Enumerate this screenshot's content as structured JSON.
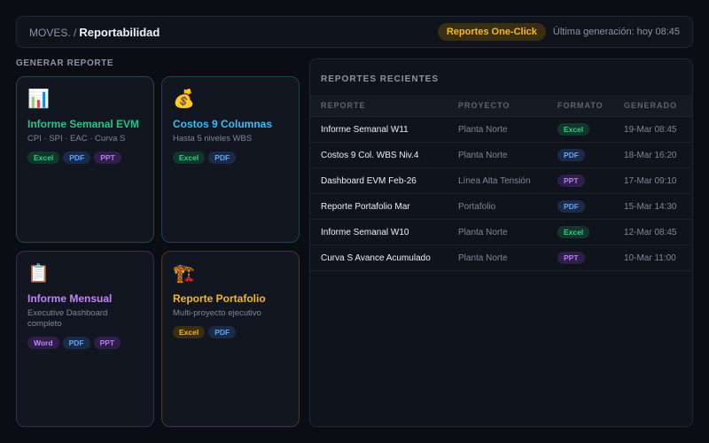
{
  "header": {
    "brand": "MOVES. /",
    "title": "Reportabilidad",
    "badge": "Reportes One-Click",
    "last_generation": "Última generación: hoy 08:45"
  },
  "section_label": "GENERAR REPORTE",
  "cards": [
    {
      "icon": "📊",
      "icon_name": "bar-chart-icon",
      "title": "Informe Semanal EVM",
      "subtitle": "CPI · SPI · EAC · Curva S",
      "formats": [
        "Excel",
        "PDF",
        "PPT"
      ],
      "color": "#22c58b"
    },
    {
      "icon": "💰",
      "icon_name": "money-bag-icon",
      "title": "Costos 9 Columnas",
      "subtitle": "Hasta 5 niveles WBS",
      "formats": [
        "Excel",
        "PDF"
      ],
      "color": "#38bdf8"
    },
    {
      "icon": "📋",
      "icon_name": "clipboard-icon",
      "title": "Informe Mensual",
      "subtitle": "Executive Dashboard completo",
      "formats": [
        "Word",
        "PDF",
        "PPT"
      ],
      "color": "#c084fc"
    },
    {
      "icon": "🏗️",
      "icon_name": "crane-icon",
      "title": "Reporte Portafolio",
      "subtitle": "Multi-proyecto ejecutivo",
      "formats": [
        "Excel",
        "PDF"
      ],
      "color": "#f5b820"
    }
  ],
  "recent": {
    "title": "REPORTES RECIENTES",
    "columns": [
      "REPORTE",
      "PROYECTO",
      "FORMATO",
      "GENERADO"
    ],
    "rows": [
      {
        "report": "Informe Semanal W11",
        "project": "Planta Norte",
        "format": "Excel",
        "generated": "19-Mar 08:45"
      },
      {
        "report": "Costos 9 Col. WBS Niv.4",
        "project": "Planta Norte",
        "format": "PDF",
        "generated": "18-Mar 16:20"
      },
      {
        "report": "Dashboard EVM Feb-26",
        "project": "Línea Alta Tensión",
        "format": "PPT",
        "generated": "17-Mar 09:10"
      },
      {
        "report": "Reporte Portafolio Mar",
        "project": "Portafolio",
        "format": "PDF",
        "generated": "15-Mar 14:30"
      },
      {
        "report": "Informe Semanal W10",
        "project": "Planta Norte",
        "format": "Excel",
        "generated": "12-Mar 08:45"
      },
      {
        "report": "Curva S Avance Acumulado",
        "project": "Planta Norte",
        "format": "PPT",
        "generated": "10-Mar 11:00"
      }
    ]
  }
}
